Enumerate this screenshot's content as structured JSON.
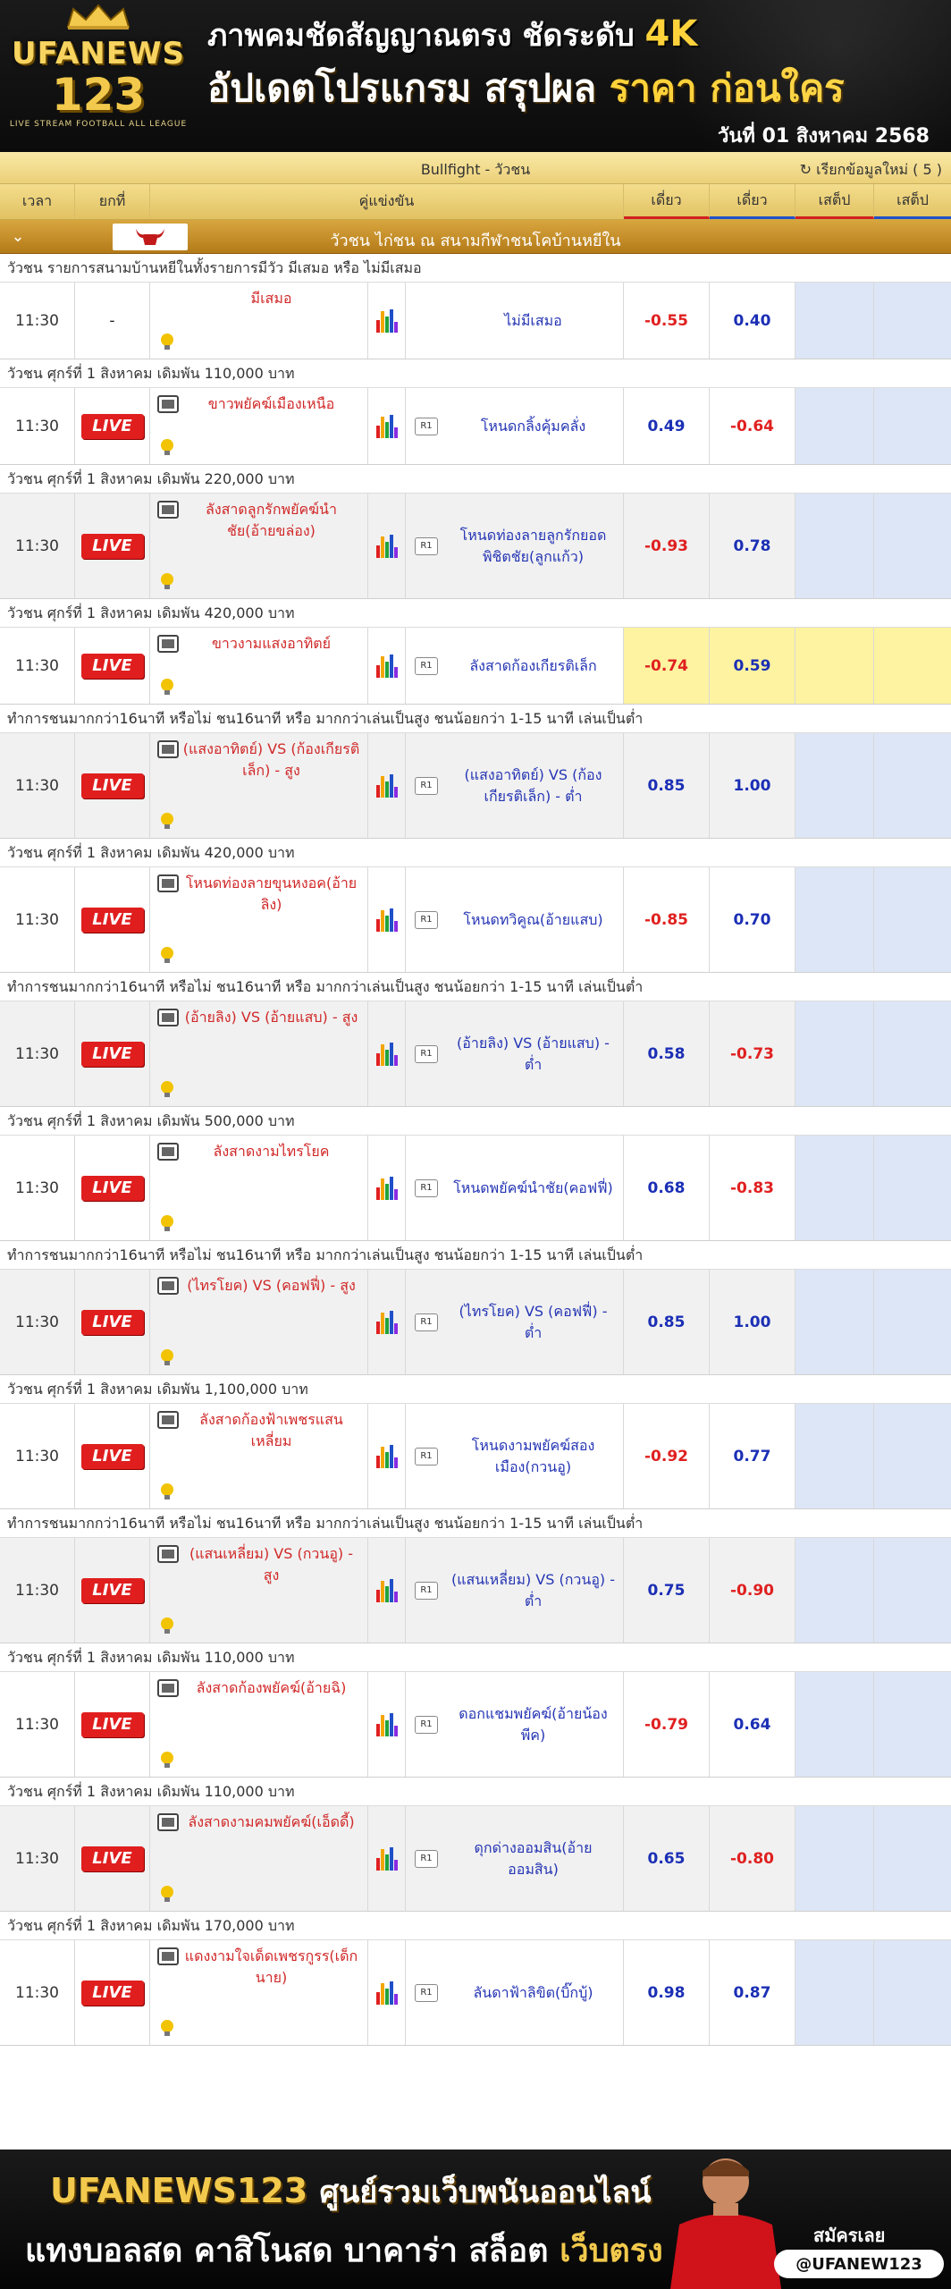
{
  "banner": {
    "brand": "UFANEWS",
    "brand_num": "123",
    "tagline": "LIVE STREAM FOOTBALL ALL LEAGUE",
    "headline1": "ภาพคมชัดสัญญาณตรง ชัดระดับ",
    "headline1_hl": "4K",
    "headline2_a": "อัปเดตโปรแกรม สรุปผล",
    "headline2_b": "ราคา ก่อนใคร",
    "date": "วันที่ 01 สิงหาคม 2568"
  },
  "table": {
    "title": "Bullfight - วัวชน",
    "refresh": "เรียกข้อมูลใหม่ ( 5 )",
    "headers": {
      "time": "เวลา",
      "lead": "ยกที่",
      "match": "คู่แข่งขัน",
      "single1": "เดี่ยว",
      "single2": "เดี่ยว",
      "step1": "เสต็ป",
      "step2": "เสต็ป"
    },
    "league": "วัวชน ไก่ชน ณ สนามกีฬาชนโคบ้านหยีใน",
    "colors": {
      "accent_red": "#d21f1f",
      "accent_blue": "#2050c8",
      "live_red": "#e01e1e"
    }
  },
  "matches": [
    {
      "note": "วัวชน รายการสนามบ้านหยีในทั้งรายการมีวัว มีเสมอ หรือ ไม่มีเสมอ",
      "time": "11:30",
      "live": "-",
      "home": "มีเสมอ",
      "away": "ไม่มีเสมอ",
      "odd1": "-0.55",
      "odd2": "0.40",
      "tv": false,
      "r1": false,
      "shade": false
    },
    {
      "note": "วัวชน ศุกร์ที่ 1 สิงหาคม เดิมพัน 110,000 บาท",
      "time": "11:30",
      "live": "LIVE",
      "home": "ขาวพยัคฆ์เมืองเหนือ",
      "away": "โหนดกลิ้งคุ้มคลั่ง",
      "odd1": "0.49",
      "odd2": "-0.64",
      "tv": true,
      "r1": true,
      "shade": false
    },
    {
      "note": "วัวชน ศุกร์ที่ 1 สิงหาคม เดิมพัน 220,000 บาท",
      "time": "11:30",
      "live": "LIVE",
      "home": "ลังสาดลูกรักพยัคฆ์นำชัย(อ้ายขล่อง)",
      "away": "โหนดท่องลายลูกรักยอดพิชิตชัย(ลูกแก้ว)",
      "odd1": "-0.93",
      "odd2": "0.78",
      "tv": true,
      "r1": true,
      "shade": true
    },
    {
      "note": "วัวชน ศุกร์ที่ 1 สิงหาคม เดิมพัน 420,000 บาท",
      "time": "11:30",
      "live": "LIVE",
      "home": "ขาวงามแสงอาทิตย์",
      "away": "ลังสาดก้องเกียรติเล็ก",
      "odd1": "-0.74",
      "odd2": "0.59",
      "tv": true,
      "r1": true,
      "shade": false,
      "highlight": true
    },
    {
      "note": "ทำการชนมากกว่า16นาที หรือไม่ ชน16นาที หรือ มากกว่าเล่นเป็นสูง ชนน้อยกว่า 1-15 นาที เล่นเป็นต่ำ",
      "time": "11:30",
      "live": "LIVE",
      "home": "(แสงอาทิตย์) VS (ก้องเกียรติเล็ก) - สูง",
      "away": "(แสงอาทิตย์) VS (ก้องเกียรติเล็ก) - ต่ำ",
      "odd1": "0.85",
      "odd2": "1.00",
      "tv": true,
      "r1": true,
      "shade": true
    },
    {
      "note": "วัวชน ศุกร์ที่ 1 สิงหาคม เดิมพัน 420,000 บาท",
      "time": "11:30",
      "live": "LIVE",
      "home": "โหนดท่องลายขุนหงอค(อ้ายลิง)",
      "away": "โหนดทวิคูณ(อ้ายแสบ)",
      "odd1": "-0.85",
      "odd2": "0.70",
      "tv": true,
      "r1": true,
      "shade": false
    },
    {
      "note": "ทำการชนมากกว่า16นาที หรือไม่ ชน16นาที หรือ มากกว่าเล่นเป็นสูง ชนน้อยกว่า 1-15 นาที เล่นเป็นต่ำ",
      "time": "11:30",
      "live": "LIVE",
      "home": "(อ้ายลิง) VS (อ้ายแสบ) - สูง",
      "away": "(อ้ายลิง) VS (อ้ายแสบ) - ต่ำ",
      "odd1": "0.58",
      "odd2": "-0.73",
      "tv": true,
      "r1": true,
      "shade": true
    },
    {
      "note": "วัวชน ศุกร์ที่ 1 สิงหาคม เดิมพัน 500,000 บาท",
      "time": "11:30",
      "live": "LIVE",
      "home": "ลังสาดงามไทรโยค",
      "away": "โหนดพยัคฆ์นำชัย(คอฟฟี่)",
      "odd1": "0.68",
      "odd2": "-0.83",
      "tv": true,
      "r1": true,
      "shade": false
    },
    {
      "note": "ทำการชนมากกว่า16นาที หรือไม่ ชน16นาที หรือ มากกว่าเล่นเป็นสูง ชนน้อยกว่า 1-15 นาที เล่นเป็นต่ำ",
      "time": "11:30",
      "live": "LIVE",
      "home": "(ไทรโยค) VS (คอฟฟี่) - สูง",
      "away": "(ไทรโยค) VS (คอฟฟี่) - ต่ำ",
      "odd1": "0.85",
      "odd2": "1.00",
      "tv": true,
      "r1": true,
      "shade": true
    },
    {
      "note": "วัวชน ศุกร์ที่ 1 สิงหาคม เดิมพัน 1,100,000 บาท",
      "time": "11:30",
      "live": "LIVE",
      "home": "ลังสาดก้องฟ้าเพชรแสนเหลี่ยม",
      "away": "โหนดงามพยัคฆ์สองเมือง(กวนอู)",
      "odd1": "-0.92",
      "odd2": "0.77",
      "tv": true,
      "r1": true,
      "shade": false
    },
    {
      "note": "ทำการชนมากกว่า16นาที หรือไม่ ชน16นาที หรือ มากกว่าเล่นเป็นสูง ชนน้อยกว่า 1-15 นาที เล่นเป็นต่ำ",
      "time": "11:30",
      "live": "LIVE",
      "home": "(แสนเหลี่ยม) VS (กวนอู) - สูง",
      "away": "(แสนเหลี่ยม) VS (กวนอู) - ต่ำ",
      "odd1": "0.75",
      "odd2": "-0.90",
      "tv": true,
      "r1": true,
      "shade": true
    },
    {
      "note": "วัวชน ศุกร์ที่ 1 สิงหาคม เดิมพัน 110,000 บาท",
      "time": "11:30",
      "live": "LIVE",
      "home": "ลังสาดก้องพยัคฆ์(อ้ายฉิ)",
      "away": "ดอกแชมพยัคฆ์(อ้ายน้องพีค)",
      "odd1": "-0.79",
      "odd2": "0.64",
      "tv": true,
      "r1": true,
      "shade": false
    },
    {
      "note": "วัวชน ศุกร์ที่ 1 สิงหาคม เดิมพัน 110,000 บาท",
      "time": "11:30",
      "live": "LIVE",
      "home": "ลังสาดงามคมพยัคฆ์(เอ็ดดี้)",
      "away": "ดุกด่างออมสิน(อ้ายออมสิน)",
      "odd1": "0.65",
      "odd2": "-0.80",
      "tv": true,
      "r1": true,
      "shade": true
    },
    {
      "note": "วัวชน ศุกร์ที่ 1 สิงหาคม เดิมพัน 170,000 บาท",
      "time": "11:30",
      "live": "LIVE",
      "home": "แดงงามใจเด็ดเพชรกูรร(เด็กนาย)",
      "away": "ลันดาฟ้าลิขิต(บิ๊กบู้)",
      "odd1": "0.98",
      "odd2": "0.87",
      "tv": true,
      "r1": true,
      "shade": false
    }
  ],
  "footer": {
    "brand": "UFANEWS123",
    "line1": "ศูนย์รวมเว็บพนันออนไลน์",
    "line2_a": "แทงบอลสด คาสิโนสด บาคาร่า สล็อต",
    "line2_b": "เว็บตรง",
    "join": "สมัครเลย",
    "handle": "@UFANEW123"
  }
}
